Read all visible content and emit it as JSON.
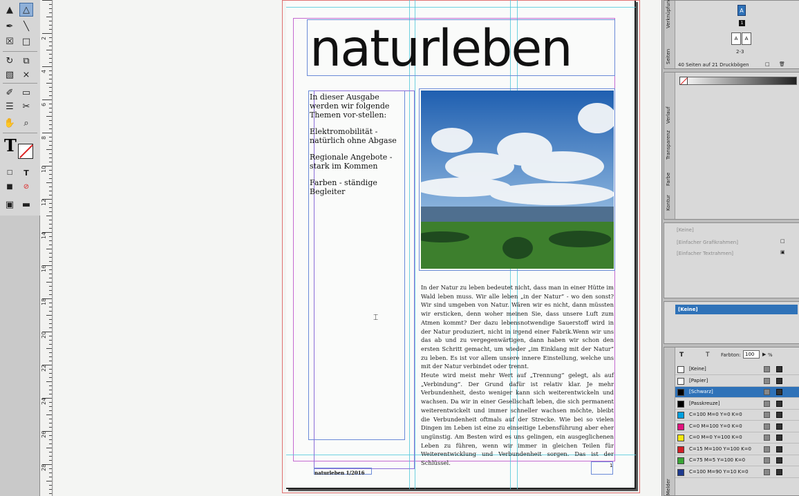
{
  "document": {
    "title": "naturleben",
    "sidebar_paragraphs": [
      "In dieser Ausgabe werden wir folgende Themen vor-stellen:",
      "Elektromobilität - natürlich ohne Abgase",
      "Regionale Angebote - stark im Kommen",
      "Farben - ständige Begleiter"
    ],
    "body_paragraphs": [
      "In der Natur zu leben bedeutet nicht, dass man in einer Hütte im Wald leben muss. Wir alle leben „in der Natur“ - wo den sonst? Wir sind umgeben von Natur. Wären wir es nicht, dann müssten wir ersticken, denn woher meinen Sie, dass unsere Luft zum Atmen kommt? Der dazu lebensnotwendige Sauerstoff wird in der Natur produziert, nicht in irgend einer Fabrik.Wenn wir uns das ab und zu vergegenwärtigen, dann haben wir schon den ersten Schritt gemacht, um wieder „im Einklang mit der Natur“ zu leben. Es ist vor allem unsere innere Einstellung, welche uns mit der Natur verbindet oder trennt.",
      "Heute wird meist mehr Wert auf „Trennung“ gelegt, als auf „Verbindung“. Der Grund dafür ist relativ klar. Je mehr Verbundenheit, desto weniger kann sich weiterentwickeln und wachsen. Da wir in einer Gesellschaft leben, die sich permanent weiterentwickelt und immer schneller wachsen möchte, bleibt die Verbundenheit oftmals auf der Strecke. Wie bei so vielen Dingen im Leben ist eine zu einseitige Lebensführung aber eher ungünstig. Am Besten wird es uns gelingen, ein ausgeglichenen Leben zu führen, wenn wir immer in gleichen Teilen für Weiterentwicklung und Verbundenheit sorgen. Das ist der Schlüssel."
    ],
    "footer": "naturleben 1/2016",
    "page_number": "1"
  },
  "pages_panel": {
    "tabs": [
      "Seiten",
      "Verknüpfungen"
    ],
    "master_label": "A",
    "spread_label": "2-3",
    "page_label_a": "A",
    "status": "40 Seiten auf 21 Druckbögen"
  },
  "color_panel": {
    "tabs": [
      "Kontur",
      "Farbe",
      "Transparenz",
      "Verlauf"
    ]
  },
  "object_styles": {
    "items": [
      "[Keine]",
      "[Einfacher Grafikrahmen]",
      "[Einfacher Textrahmen]"
    ]
  },
  "paragraph_styles": {
    "selected": "[Keine]"
  },
  "swatches": {
    "tint_label": "Farbton:",
    "tint_value": "100",
    "tint_unit": "%",
    "items": [
      {
        "name": "[Keine]",
        "color": "#ffffff"
      },
      {
        "name": "[Papier]",
        "color": "#ffffff"
      },
      {
        "name": "[Schwarz]",
        "color": "#000000"
      },
      {
        "name": "[Passkreuze]",
        "color": "#000000"
      },
      {
        "name": "C=100 M=0 Y=0 K=0",
        "color": "#00a0e0"
      },
      {
        "name": "C=0 M=100 Y=0 K=0",
        "color": "#e0127d"
      },
      {
        "name": "C=0 M=0 Y=100 K=0",
        "color": "#f5e70f"
      },
      {
        "name": "C=15 M=100 Y=100 K=0",
        "color": "#d11f26"
      },
      {
        "name": "C=75 M=5 Y=100 K=0",
        "color": "#3aa536"
      },
      {
        "name": "C=100 M=90 Y=10 K=0",
        "color": "#1e3a8f"
      }
    ],
    "bottom_tab": "Melder"
  },
  "ruler": {
    "numbers": [
      "2",
      "4",
      "6",
      "8",
      "10",
      "12",
      "14",
      "16",
      "18",
      "20",
      "22",
      "24",
      "26",
      "28"
    ]
  }
}
